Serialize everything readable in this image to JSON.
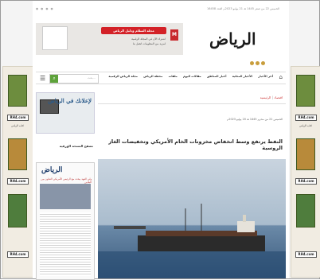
{
  "topbar": {
    "date": "الخميس 22 من صفر 1445 هـ 21 يوليو 2023م العدد 16458",
    "social": "● ● ● ●"
  },
  "header_ad": {
    "cta": "مجلة السلام ودليل الرياض",
    "line1": "اشترك الآن في المجلة الرقمية",
    "line2": "لمزيد من المعلومات اتصل بنا",
    "mbc": "M"
  },
  "brand": {
    "logo": "الرياض"
  },
  "nav": {
    "items": [
      "أخر الأخبار",
      "الأخبار المحلية",
      "أخبار المناطق",
      "مقالات اليوم",
      "ملفات",
      "محطة الرياض",
      "مجلة الرياض الرقمية"
    ]
  },
  "search": {
    "placeholder": "بحث..."
  },
  "sidebar": {
    "ad_text": "لإعلانك في الرياض",
    "heading": "تصفح النسخة الورقية",
    "paper_masthead": "الرياض",
    "paper_headline": "ولي العهد يبحث مع الرئيس الأمريكي التعاون بين البلدين"
  },
  "article": {
    "crumbs": [
      "الرئيسية",
      "اقتصاد"
    ],
    "meta": "الخميس 21 من محرم 1445 هـ 20 يوليو 2023م",
    "title": "النفط يرتفع وسط انخفاض مخزونات الخام الأمريكي وتخفيضات الغاز الروسية"
  },
  "side_ads": {
    "left_logo": "RH4.com",
    "right_logo": "RH4.com",
    "caption": "كتاب الرياض"
  }
}
